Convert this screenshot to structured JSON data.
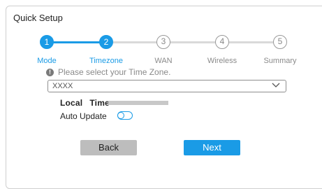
{
  "panel": {
    "title": "Quick Setup"
  },
  "steps": [
    {
      "number": "1",
      "label": "Mode",
      "state": "active"
    },
    {
      "number": "2",
      "label": "Timezone",
      "state": "active"
    },
    {
      "number": "3",
      "label": "WAN",
      "state": "inactive"
    },
    {
      "number": "4",
      "label": "Wireless",
      "state": "inactive"
    },
    {
      "number": "5",
      "label": "Summary",
      "state": "inactive"
    }
  ],
  "hint": {
    "icon": "info-icon",
    "text": "Please select your Time Zone."
  },
  "timezone_select": {
    "value": "XXXX",
    "icon": "chevron-down-icon"
  },
  "local_time": {
    "label_1": "Local",
    "label_2": "Time"
  },
  "auto_update": {
    "label": "Auto Update",
    "enabled": false
  },
  "buttons": {
    "back": "Back",
    "next": "Next"
  },
  "colors": {
    "accent": "#1a9be6",
    "inactive": "#9a9a9a",
    "back_button": "#bdbdbd"
  }
}
